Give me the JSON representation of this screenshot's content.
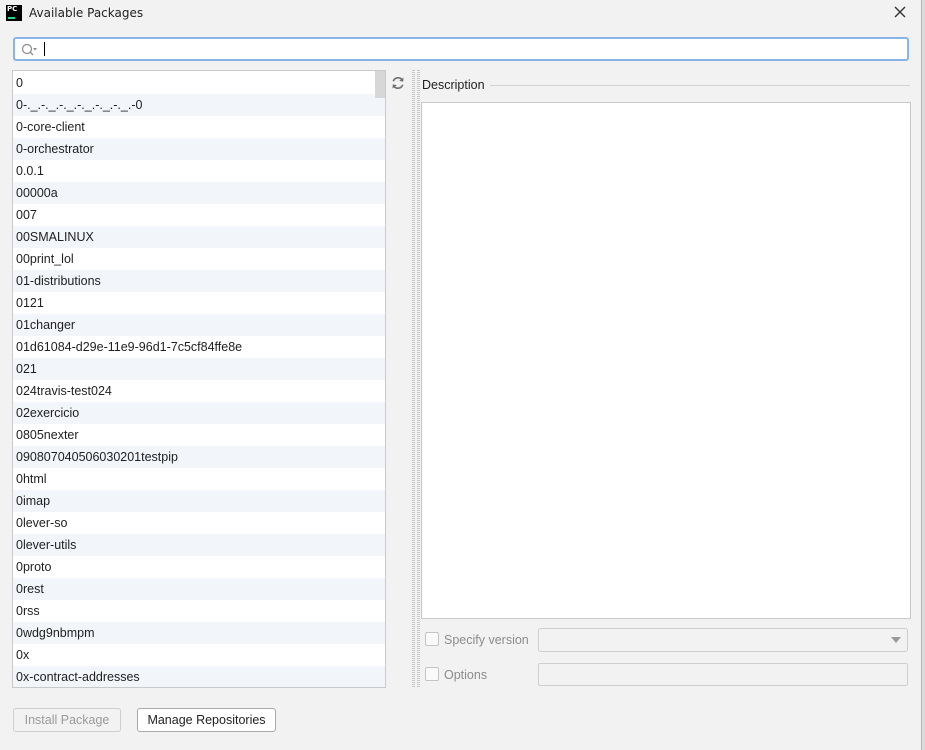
{
  "window": {
    "title": "Available Packages",
    "app_icon_text": "PC",
    "icons": {
      "app": "pycharm-icon",
      "close": "close-icon"
    }
  },
  "search": {
    "value": "",
    "placeholder": "",
    "icon": "search-icon"
  },
  "packages": [
    "0",
    "0-._.-._.-._.-._.-._.-._.-0",
    "0-core-client",
    "0-orchestrator",
    "0.0.1",
    "00000a",
    "007",
    "00SMALINUX",
    "00print_lol",
    "01-distributions",
    "0121",
    "01changer",
    "01d61084-d29e-11e9-96d1-7c5cf84ffe8e",
    "021",
    "024travis-test024",
    "02exercicio",
    "0805nexter",
    "090807040506030201testpip",
    "0html",
    "0imap",
    "0lever-so",
    "0lever-utils",
    "0proto",
    "0rest",
    "0rss",
    "0wdg9nbmpm",
    "0x",
    "0x-contract-addresses"
  ],
  "refresh": {
    "icon": "refresh-icon"
  },
  "description": {
    "label": "Description",
    "text": ""
  },
  "options": {
    "specify_version_label": "Specify version",
    "specify_version_checked": false,
    "version_value": "",
    "options_label": "Options",
    "options_checked": false,
    "options_value": ""
  },
  "buttons": {
    "install_label": "Install Package",
    "manage_label": "Manage Repositories"
  },
  "colors": {
    "focus_border": "#8ab4e6",
    "row_alt": "#f2f5f9",
    "background": "#f2f2f2",
    "disabled_text": "#9a9a9a"
  }
}
